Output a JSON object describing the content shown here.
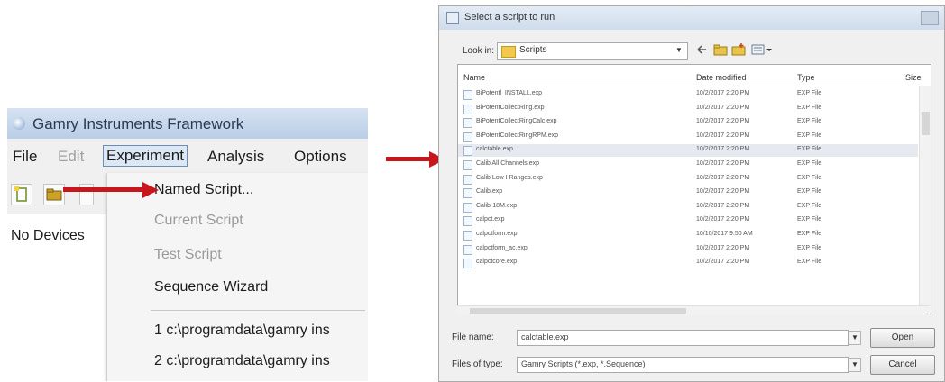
{
  "framework": {
    "title": "Gamry Instruments Framework",
    "menu": {
      "file": "File",
      "edit": "Edit",
      "experiment": "Experiment",
      "analysis": "Analysis",
      "options": "Options"
    },
    "devices_label": "No Devices",
    "experiment_menu": {
      "named_script": "Named Script...",
      "current_script": "Current Script",
      "test_script": "Test Script",
      "sequence_wizard": "Sequence Wizard",
      "recent_1": "1 c:\\programdata\\gamry ins",
      "recent_2": "2 c:\\programdata\\gamry ins"
    }
  },
  "dialog": {
    "title": "Select a script to run",
    "look_in_label": "Look in:",
    "look_in_value": "Scripts",
    "columns": {
      "name": "Name",
      "date": "Date modified",
      "type": "Type",
      "size": "Size"
    },
    "files": [
      {
        "name": "BiPotentl_INSTALL.exp",
        "date": "10/2/2017 2:20 PM",
        "type": "EXP File"
      },
      {
        "name": "BiPotentCollectRing.exp",
        "date": "10/2/2017 2:20 PM",
        "type": "EXP File"
      },
      {
        "name": "BiPotentCollectRingCalc.exp",
        "date": "10/2/2017 2:20 PM",
        "type": "EXP File"
      },
      {
        "name": "BiPotentCollectRingRPM.exp",
        "date": "10/2/2017 2:20 PM",
        "type": "EXP File"
      },
      {
        "name": "calctable.exp",
        "date": "10/2/2017 2:20 PM",
        "type": "EXP File"
      },
      {
        "name": "Calib All Channels.exp",
        "date": "10/2/2017 2:20 PM",
        "type": "EXP File"
      },
      {
        "name": "Calib Low I Ranges.exp",
        "date": "10/2/2017 2:20 PM",
        "type": "EXP File"
      },
      {
        "name": "Calib.exp",
        "date": "10/2/2017 2:20 PM",
        "type": "EXP File"
      },
      {
        "name": "Calib-18M.exp",
        "date": "10/2/2017 2:20 PM",
        "type": "EXP File"
      },
      {
        "name": "calpct.exp",
        "date": "10/2/2017 2:20 PM",
        "type": "EXP File"
      },
      {
        "name": "calpctform.exp",
        "date": "10/10/2017 9:50 AM",
        "type": "EXP File"
      },
      {
        "name": "calpctform_ac.exp",
        "date": "10/2/2017 2:20 PM",
        "type": "EXP File"
      },
      {
        "name": "calpctcore.exp",
        "date": "10/2/2017 2:20 PM",
        "type": "EXP File"
      }
    ],
    "filename_label": "File name:",
    "filename_value": "calctable.exp",
    "filetype_label": "Files of type:",
    "filetype_value": "Gamry Scripts (*.exp, *.Sequence)",
    "open_label": "Open",
    "cancel_label": "Cancel"
  },
  "colors": {
    "arrow": "#c8161d",
    "selected_row": "#e6eaf0"
  }
}
